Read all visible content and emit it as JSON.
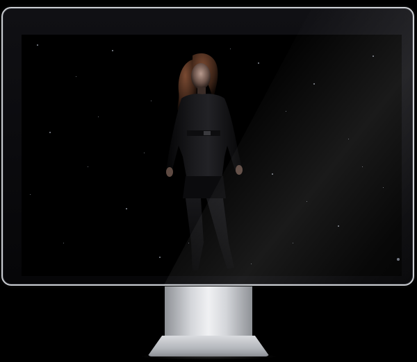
{
  "scene": {
    "subject": "person-photo",
    "screen_background": "#000000",
    "bezel_color": "#0a0a0d",
    "frame_color": "#c9ccd1",
    "stand_color": "#d4d6da"
  }
}
